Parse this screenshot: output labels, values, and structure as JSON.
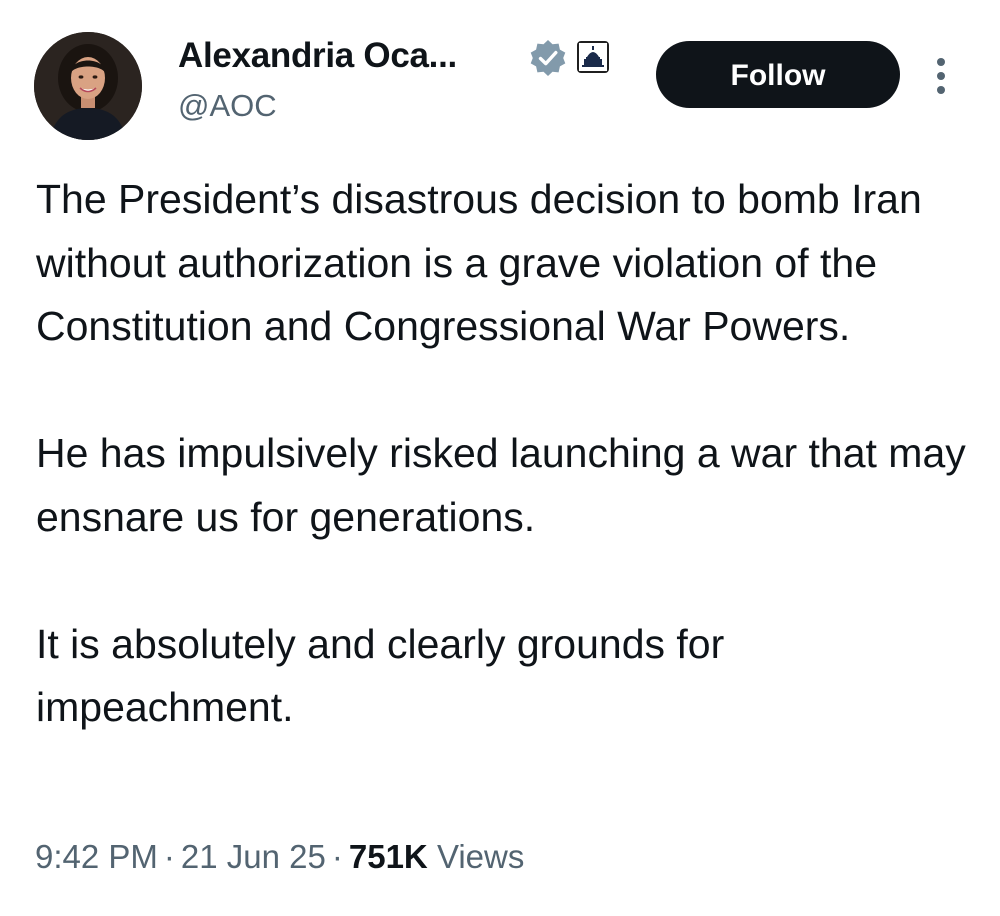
{
  "user": {
    "display_name": "Alexandria Oca...",
    "handle": "@AOC",
    "verified_badge": "verified-badge-icon",
    "affiliation_badge": "capitol-building-icon",
    "verified_color": "#829aab"
  },
  "actions": {
    "follow_label": "Follow",
    "more_icon": "more-vertical-icon"
  },
  "tweet": {
    "paragraphs": [
      "The President’s disastrous decision to bomb Iran without authorization is a grave violation of the Constitution and Congressional War Powers.",
      "He has impulsively risked launching a war that may ensnare us for generations.",
      "It is absolutely and clearly grounds for impeachment."
    ],
    "time": "9:42 PM",
    "date": "21 Jun 25",
    "separator": "·",
    "views_count": "751K",
    "views_label": "Views"
  }
}
